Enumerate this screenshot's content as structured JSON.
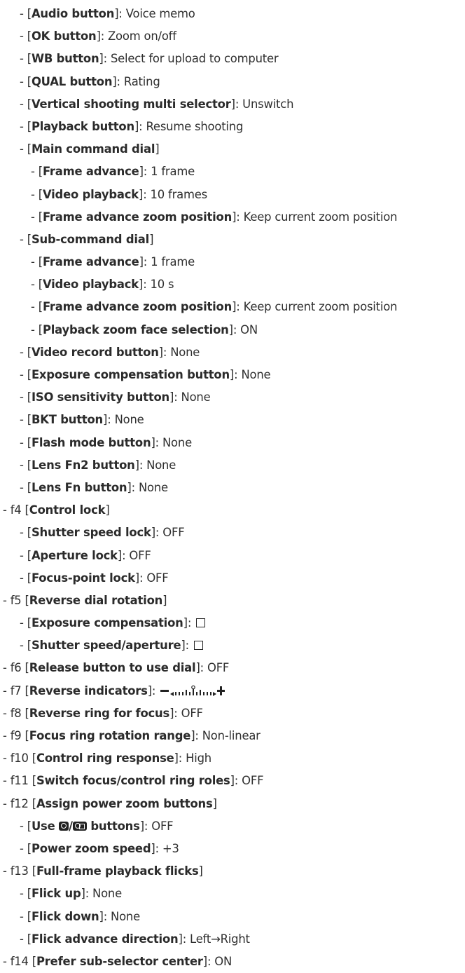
{
  "items": [
    {
      "dash": "-",
      "code": "",
      "name": "Audio button",
      "sep": ": ",
      "value": "Voice memo"
    },
    {
      "dash": "-",
      "code": "",
      "name": "OK button",
      "sep": ": ",
      "value": "Zoom on/off"
    },
    {
      "dash": "-",
      "code": "",
      "name": "WB button",
      "sep": ": ",
      "value": "Select for upload to computer"
    },
    {
      "dash": "-",
      "code": "",
      "name": "QUAL button",
      "sep": ": ",
      "value": "Rating"
    },
    {
      "dash": "-",
      "code": "",
      "name": "Vertical shooting multi selector",
      "sep": ": ",
      "value": "Unswitch"
    },
    {
      "dash": "-",
      "code": "",
      "name": "Playback button",
      "sep": ": ",
      "value": "Resume shooting"
    },
    {
      "dash": "-",
      "code": "",
      "name": "Main command dial",
      "sep": "",
      "value": ""
    },
    {
      "dash": "-",
      "code": "",
      "name": "Frame advance",
      "sep": ": ",
      "value": "1 frame"
    },
    {
      "dash": "-",
      "code": "",
      "name": "Video playback",
      "sep": ": ",
      "value": "10 frames"
    },
    {
      "dash": "-",
      "code": "",
      "name": "Frame advance zoom position",
      "sep": ": ",
      "value": "Keep current zoom position"
    },
    {
      "dash": "-",
      "code": "",
      "name": "Sub-command dial",
      "sep": "",
      "value": ""
    },
    {
      "dash": "-",
      "code": "",
      "name": "Frame advance",
      "sep": ": ",
      "value": "1 frame"
    },
    {
      "dash": "-",
      "code": "",
      "name": "Video playback",
      "sep": ": ",
      "value": "10 s"
    },
    {
      "dash": "-",
      "code": "",
      "name": "Frame advance zoom position",
      "sep": ": ",
      "value": "Keep current zoom position"
    },
    {
      "dash": "-",
      "code": "",
      "name": "Playback zoom face selection",
      "sep": ": ",
      "value": "ON"
    },
    {
      "dash": "-",
      "code": "",
      "name": "Video record button",
      "sep": ": ",
      "value": "None"
    },
    {
      "dash": "-",
      "code": "",
      "name": "Exposure compensation button",
      "sep": ": ",
      "value": "None"
    },
    {
      "dash": "-",
      "code": "",
      "name": "ISO sensitivity button",
      "sep": ": ",
      "value": "None"
    },
    {
      "dash": "-",
      "code": "",
      "name": "BKT button",
      "sep": ": ",
      "value": "None"
    },
    {
      "dash": "-",
      "code": "",
      "name": "Flash mode button",
      "sep": ": ",
      "value": "None"
    },
    {
      "dash": "-",
      "code": "",
      "name": "Lens Fn2 button",
      "sep": ": ",
      "value": "None"
    },
    {
      "dash": "-",
      "code": "",
      "name": "Lens Fn button",
      "sep": ": ",
      "value": "None"
    },
    {
      "dash": "-",
      "code": "f4 ",
      "name": "Control lock",
      "sep": "",
      "value": ""
    },
    {
      "dash": "-",
      "code": "",
      "name": "Shutter speed lock",
      "sep": ": ",
      "value": "OFF"
    },
    {
      "dash": "-",
      "code": "",
      "name": "Aperture lock",
      "sep": ": ",
      "value": "OFF"
    },
    {
      "dash": "-",
      "code": "",
      "name": "Focus-point lock",
      "sep": ": ",
      "value": "OFF"
    },
    {
      "dash": "-",
      "code": "f5 ",
      "name": "Reverse dial rotation",
      "sep": "",
      "value": ""
    },
    {
      "dash": "-",
      "code": "",
      "name": "Exposure compensation",
      "sep": ": ",
      "value": "",
      "icon": "checkbox-icon"
    },
    {
      "dash": "-",
      "code": "",
      "name": "Shutter speed/aperture",
      "sep": ": ",
      "value": "",
      "icon": "checkbox-icon"
    },
    {
      "dash": "-",
      "code": "f6 ",
      "name": "Release button to use dial",
      "sep": ": ",
      "value": "OFF"
    },
    {
      "dash": "-",
      "code": "f7 ",
      "name": "Reverse indicators",
      "sep": ": ",
      "value": "",
      "icon": "exposure-indicator-icon"
    },
    {
      "dash": "-",
      "code": "f8 ",
      "name": "Reverse ring for focus",
      "sep": ": ",
      "value": "OFF"
    },
    {
      "dash": "-",
      "code": "f9 ",
      "name": "Focus ring rotation range",
      "sep": ": ",
      "value": "Non-linear"
    },
    {
      "dash": "-",
      "code": "f10 ",
      "name": "Control ring response",
      "sep": ": ",
      "value": "High"
    },
    {
      "dash": "-",
      "code": "f11 ",
      "name": "Switch focus/control ring roles",
      "sep": ": ",
      "value": "OFF"
    },
    {
      "dash": "-",
      "code": "f12 ",
      "name": "Assign power zoom buttons",
      "sep": "",
      "value": ""
    },
    {
      "dash": "-",
      "code": "",
      "name": "",
      "name_pre": "Use ",
      "name_post": " buttons",
      "sep": ": ",
      "value": "OFF",
      "icon": "zoom-buttons-icon"
    },
    {
      "dash": "-",
      "code": "",
      "name": "Power zoom speed",
      "sep": ": ",
      "value": "+3"
    },
    {
      "dash": "-",
      "code": "f13 ",
      "name": "Full-frame playback flicks",
      "sep": "",
      "value": ""
    },
    {
      "dash": "-",
      "code": "",
      "name": "Flick up",
      "sep": ": ",
      "value": "None"
    },
    {
      "dash": "-",
      "code": "",
      "name": "Flick down",
      "sep": ": ",
      "value": "None"
    },
    {
      "dash": "-",
      "code": "",
      "name": "Flick advance direction",
      "sep": ": ",
      "value": "Left→Right"
    },
    {
      "dash": "-",
      "code": "f14 ",
      "name": "Prefer sub-selector center",
      "sep": ": ",
      "value": "ON"
    }
  ]
}
